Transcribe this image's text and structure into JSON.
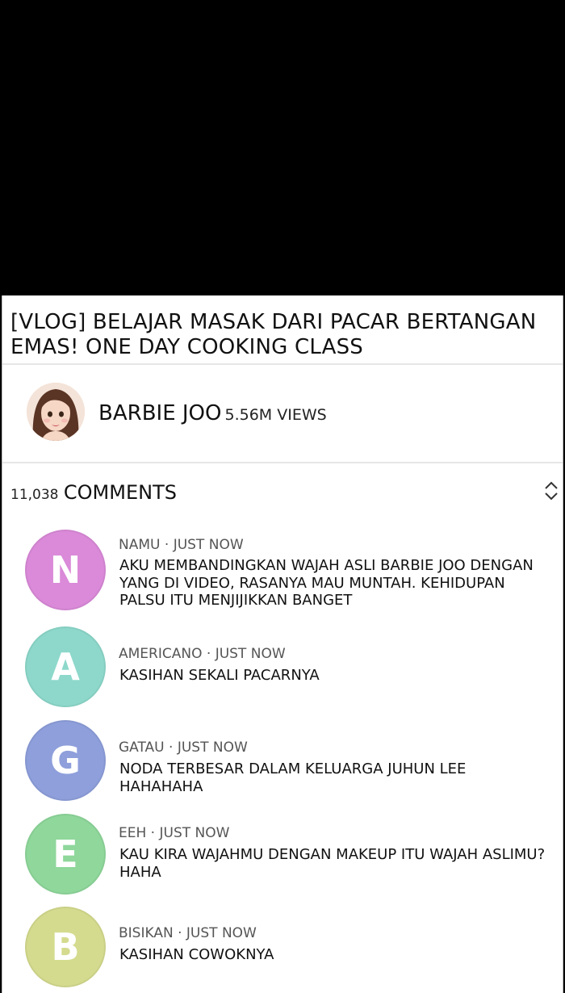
{
  "video": {
    "title": "[VLOG] BELAJAR MASAK DARI PACAR BERTANGAN EMAS! ONE DAY COOKING CLASS"
  },
  "channel": {
    "name": "BARBIE JOO",
    "views": "5.56M VIEWS"
  },
  "comments_header": {
    "count": "11,038",
    "label": "COMMENTS",
    "sort_icon": "sort-updown-icon"
  },
  "comments": [
    {
      "initial": "N",
      "avatar_color": "#da8ad8",
      "author": "NAMU",
      "separator": "·",
      "time": "JUST NOW",
      "text": "AKU MEMBANDINGKAN WAJAH ASLI BARBIE JOO DENGAN YANG DI VIDEO, RASANYA MAU MUNTAH. KEHIDUPAN PALSU ITU MENJIJIKKAN BANGET"
    },
    {
      "initial": "A",
      "avatar_color": "#8dd8cb",
      "author": "AMERICANO",
      "separator": "·",
      "time": "JUST NOW",
      "text": "KASIHAN SEKALI PACARNYA"
    },
    {
      "initial": "G",
      "avatar_color": "#8e9fdb",
      "author": "GATAU",
      "separator": "·",
      "time": "JUST NOW",
      "text": "NODA TERBESAR DALAM KELUARGA JUHUN LEE HAHAHAHA"
    },
    {
      "initial": "E",
      "avatar_color": "#8fd79b",
      "author": "EEH",
      "separator": "·",
      "time": "JUST NOW",
      "text": "KAU KIRA WAJAHMU DENGAN MAKEUP ITU WAJAH ASLIMU? HAHA"
    },
    {
      "initial": "B",
      "avatar_color": "#d4db8e",
      "author": "BISIKAN",
      "separator": "·",
      "time": "JUST NOW",
      "text": "KASIHAN COWOKNYA"
    }
  ]
}
